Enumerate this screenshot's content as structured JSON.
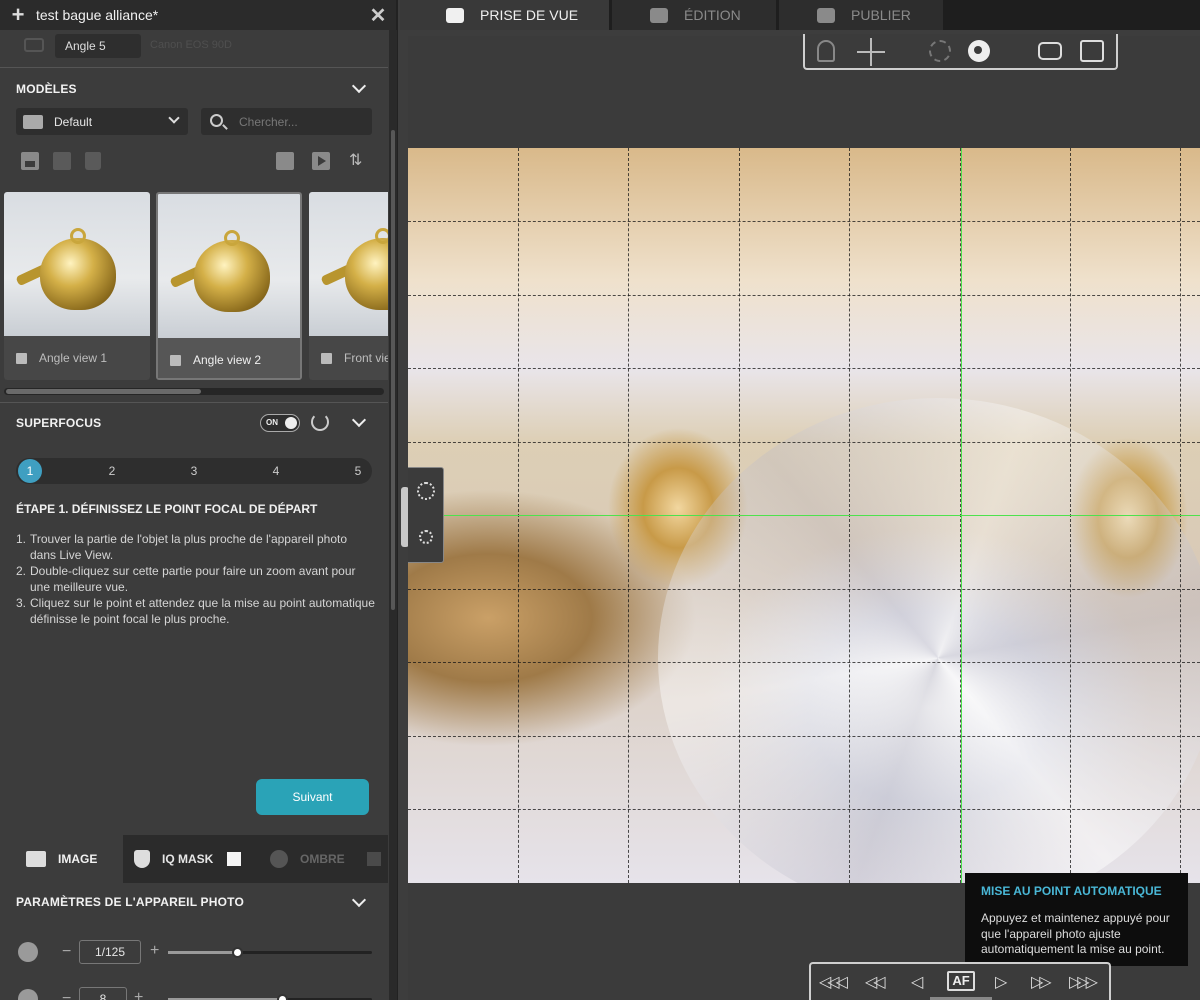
{
  "project": {
    "title": "test bague alliance*"
  },
  "angle": {
    "name": "Angle 5",
    "camera": "Canon EOS 90D"
  },
  "models": {
    "title": "MODÈLES",
    "folder": "Default",
    "search_placeholder": "Chercher...",
    "thumbnails": [
      {
        "label": "Angle view 1",
        "active": false
      },
      {
        "label": "Angle view 2",
        "active": true
      },
      {
        "label": "Front view",
        "active": false
      }
    ]
  },
  "superfocus": {
    "title": "SUPERFOCUS",
    "toggle": "ON",
    "steps": [
      "1",
      "2",
      "3",
      "4",
      "5"
    ],
    "current_step": 1,
    "step_title": "ÉTAPE 1. DÉFINISSEZ LE POINT FOCAL DE DÉPART",
    "instructions": [
      {
        "n": "1.",
        "text": "Trouver la partie de l'objet la plus proche de l'appareil photo dans Live View."
      },
      {
        "n": "2.",
        "text": "Double-cliquez sur cette partie pour faire un zoom avant pour une meilleure vue."
      },
      {
        "n": "3.",
        "text": "Cliquez sur le point et attendez que la mise au point automatique définisse le point focal le plus proche."
      }
    ],
    "next_label": "Suivant"
  },
  "bottom_tabs": {
    "image": "IMAGE",
    "iq_mask": "IQ MASK",
    "ombre": "OMBRE"
  },
  "camera_params": {
    "title": "PARAMÈTRES DE L'APPAREIL PHOTO",
    "shutter": {
      "value": "1/125",
      "level": 0.34
    },
    "aperture": {
      "value": "8",
      "level": 0.56
    }
  },
  "main_tabs": [
    {
      "label": "PRISE DE VUE",
      "active": true
    },
    {
      "label": "ÉDITION",
      "active": false
    },
    {
      "label": "PUBLIER",
      "active": false
    }
  ],
  "tooltip": {
    "title": "MISE AU POINT AUTOMATIQUE",
    "body": "Appuyez et maintenez appuyé pour que l'appareil photo ajuste automatiquement la mise au point."
  },
  "nav": {
    "af_label": "AF"
  },
  "colors": {
    "accent": "#2aa3b7",
    "step_active": "#3f9fc1",
    "tooltip_title": "#49b7d6",
    "crosshair": "#4de24d"
  }
}
